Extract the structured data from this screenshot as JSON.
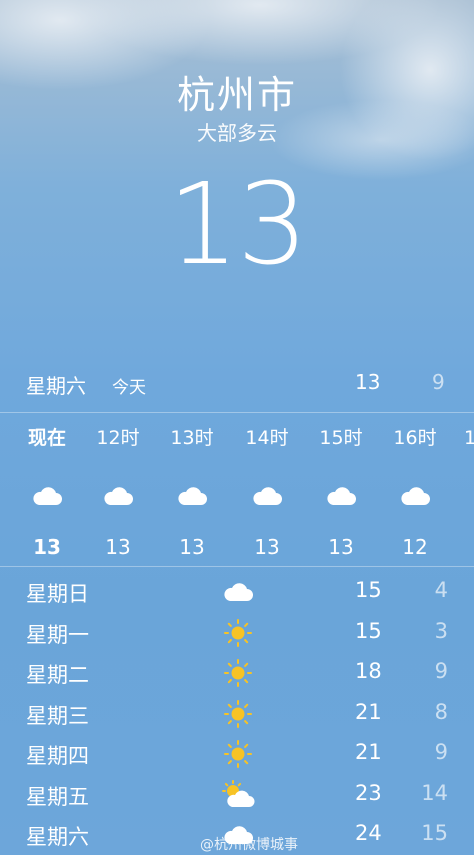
{
  "city": "杭州市",
  "condition": "大部多云",
  "current_temp": "13",
  "today": {
    "day": "星期六",
    "label": "今天",
    "high": "13",
    "low": "9"
  },
  "hourly": [
    {
      "time": "现在",
      "icon": "cloud-icon",
      "temp": "13"
    },
    {
      "time": "12时",
      "icon": "cloud-icon",
      "temp": "13"
    },
    {
      "time": "13时",
      "icon": "cloud-icon",
      "temp": "13"
    },
    {
      "time": "14时",
      "icon": "cloud-icon",
      "temp": "13"
    },
    {
      "time": "15时",
      "icon": "cloud-icon",
      "temp": "13"
    },
    {
      "time": "16时",
      "icon": "cloud-icon",
      "temp": "12"
    },
    {
      "time": "1",
      "icon": "cloud-icon",
      "temp": ""
    }
  ],
  "daily": [
    {
      "day": "星期日",
      "icon": "cloud-icon",
      "high": "15",
      "low": "4"
    },
    {
      "day": "星期一",
      "icon": "sun-icon",
      "high": "15",
      "low": "3"
    },
    {
      "day": "星期二",
      "icon": "sun-icon",
      "high": "18",
      "low": "9"
    },
    {
      "day": "星期三",
      "icon": "sun-icon",
      "high": "21",
      "low": "8"
    },
    {
      "day": "星期四",
      "icon": "sun-icon",
      "high": "21",
      "low": "9"
    },
    {
      "day": "星期五",
      "icon": "partly-cloudy-icon",
      "high": "23",
      "low": "14"
    },
    {
      "day": "星期六",
      "icon": "cloud-icon",
      "high": "24",
      "low": "15"
    }
  ],
  "watermark": "@杭州微博城事",
  "colors": {
    "sun": "#f7c325",
    "text": "#ffffff"
  }
}
